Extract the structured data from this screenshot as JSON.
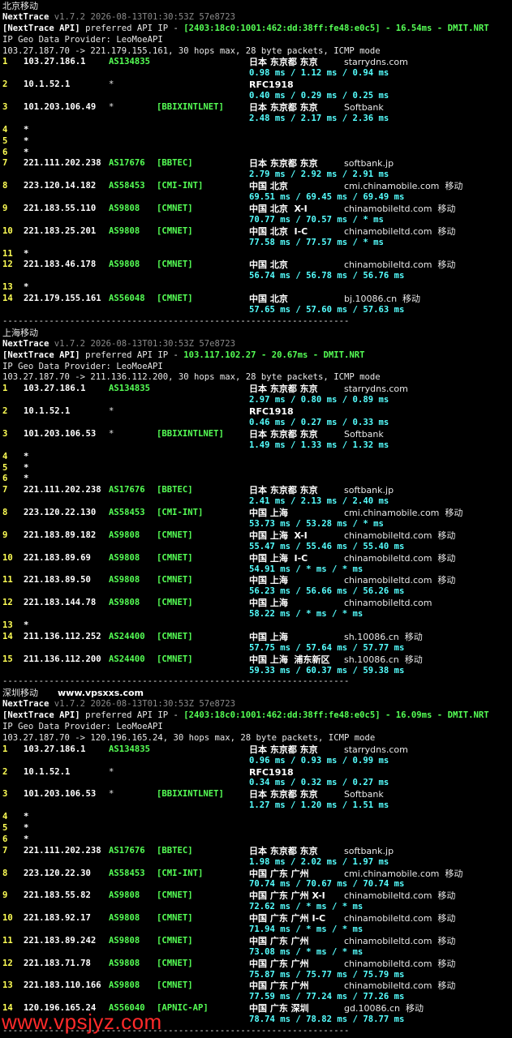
{
  "colors": {
    "hop": "#ffff55",
    "asn": "#55ff55",
    "net": "#55ff55",
    "rtt": "#55ffff",
    "geo": "#ffffff",
    "version": "#8a8a8a"
  },
  "watermark": "www.vpsjyz.com",
  "sections": [
    {
      "title": "北京移动",
      "brand": "",
      "app_name": "NextTrace",
      "version": "v1.7.2 2026-08-13T01:30:53Z 57e8723",
      "api_tag": "[NextTrace API]",
      "api_text": "preferred API IP -",
      "api_ip": "[2403:18c0:1001:462:dd:38ff:fe48:e0c5]",
      "api_latency": "- 16.54ms - DMIT.NRT",
      "geo_provider": "IP Geo Data Provider: LeoMoeAPI",
      "trace_header": "103.27.187.70 -> 221.179.155.161, 30 hops max, 28 byte packets, ICMP mode",
      "hops": [
        {
          "n": "1",
          "ip": "103.27.186.1",
          "asn": "AS134835",
          "net": "",
          "geo": "日本 东京都 东京",
          "isp": "starrydns.com",
          "rtt": "0.98 ms / 1.12 ms / 0.94 ms"
        },
        {
          "n": "2",
          "ip": "10.1.52.1",
          "asn": "*",
          "net": "",
          "geo": "RFC1918",
          "isp": "",
          "rtt": "0.40 ms / 0.29 ms / 0.25 ms"
        },
        {
          "n": "3",
          "ip": "101.203.106.49",
          "asn": "*",
          "net": "[BBIXINTLNET]",
          "geo": "日本 东京都 东京",
          "isp": "Softbank",
          "rtt": "2.48 ms / 2.17 ms / 2.36 ms"
        },
        {
          "n": "4",
          "ip": "*",
          "star": true
        },
        {
          "n": "5",
          "ip": "*",
          "star": true
        },
        {
          "n": "6",
          "ip": "*",
          "star": true
        },
        {
          "n": "7",
          "ip": "221.111.202.238",
          "asn": "AS17676",
          "net": "[BBTEC]",
          "geo": "日本 东京都 东京",
          "isp": "softbank.jp",
          "rtt": "2.79 ms / 2.92 ms / 2.91 ms"
        },
        {
          "n": "8",
          "ip": "223.120.14.182",
          "asn": "AS58453",
          "net": "[CMI-INT]",
          "geo": "中国 北京",
          "isp": "cmi.chinamobile.com  移动",
          "rtt": "69.51 ms / 69.45 ms / 69.49 ms"
        },
        {
          "n": "9",
          "ip": "221.183.55.110",
          "asn": "AS9808",
          "net": "[CMNET]",
          "geo": "中国 北京  X-I",
          "isp": "chinamobileltd.com  移动",
          "rtt": "70.77 ms / 70.57 ms / * ms"
        },
        {
          "n": "10",
          "ip": "221.183.25.201",
          "asn": "AS9808",
          "net": "[CMNET]",
          "geo": "中国 北京  I-C",
          "isp": "chinamobileltd.com  移动",
          "rtt": "77.58 ms / 77.57 ms / * ms"
        },
        {
          "n": "11",
          "ip": "*",
          "star": true
        },
        {
          "n": "12",
          "ip": "221.183.46.178",
          "asn": "AS9808",
          "net": "[CMNET]",
          "geo": "中国 北京",
          "isp": "chinamobileltd.com  移动",
          "rtt": "56.74 ms / 56.78 ms / 56.76 ms"
        },
        {
          "n": "13",
          "ip": "*",
          "star": true
        },
        {
          "n": "14",
          "ip": "221.179.155.161",
          "asn": "AS56048",
          "net": "[CMNET]",
          "geo": "中国 北京",
          "isp": "bj.10086.cn  移动",
          "rtt": "57.65 ms / 57.60 ms / 57.63 ms"
        }
      ]
    },
    {
      "title": "上海移动",
      "brand": "",
      "app_name": "NextTrace",
      "version": "v1.7.2 2026-08-13T01:30:53Z 57e8723",
      "api_tag": "[NextTrace API]",
      "api_text": "preferred API IP -",
      "api_ip": "103.117.102.27",
      "api_latency": "- 20.67ms - DMIT.NRT",
      "geo_provider": "IP Geo Data Provider: LeoMoeAPI",
      "trace_header": "103.27.187.70 -> 211.136.112.200, 30 hops max, 28 byte packets, ICMP mode",
      "hops": [
        {
          "n": "1",
          "ip": "103.27.186.1",
          "asn": "AS134835",
          "net": "",
          "geo": "日本 东京都 东京",
          "isp": "starrydns.com",
          "rtt": "2.97 ms / 0.80 ms / 0.89 ms"
        },
        {
          "n": "2",
          "ip": "10.1.52.1",
          "asn": "*",
          "net": "",
          "geo": "RFC1918",
          "isp": "",
          "rtt": "0.46 ms / 0.27 ms / 0.33 ms"
        },
        {
          "n": "3",
          "ip": "101.203.106.53",
          "asn": "*",
          "net": "[BBIXINTLNET]",
          "geo": "日本 东京都 东京",
          "isp": "Softbank",
          "rtt": "1.49 ms / 1.33 ms / 1.32 ms"
        },
        {
          "n": "4",
          "ip": "*",
          "star": true
        },
        {
          "n": "5",
          "ip": "*",
          "star": true
        },
        {
          "n": "6",
          "ip": "*",
          "star": true
        },
        {
          "n": "7",
          "ip": "221.111.202.238",
          "asn": "AS17676",
          "net": "[BBTEC]",
          "geo": "日本 东京都 东京",
          "isp": "softbank.jp",
          "rtt": "2.41 ms / 2.13 ms / 2.40 ms"
        },
        {
          "n": "8",
          "ip": "223.120.22.130",
          "asn": "AS58453",
          "net": "[CMI-INT]",
          "geo": "中国 上海",
          "isp": "cmi.chinamobile.com  移动",
          "rtt": "53.73 ms / 53.28 ms / * ms"
        },
        {
          "n": "9",
          "ip": "221.183.89.182",
          "asn": "AS9808",
          "net": "[CMNET]",
          "geo": "中国 上海  X-I",
          "isp": "chinamobileltd.com  移动",
          "rtt": "55.47 ms / 55.46 ms / 55.40 ms"
        },
        {
          "n": "10",
          "ip": "221.183.89.69",
          "asn": "AS9808",
          "net": "[CMNET]",
          "geo": "中国 上海  I-C",
          "isp": "chinamobileltd.com  移动",
          "rtt": "54.91 ms / * ms / * ms"
        },
        {
          "n": "11",
          "ip": "221.183.89.50",
          "asn": "AS9808",
          "net": "[CMNET]",
          "geo": "中国 上海",
          "isp": "chinamobileltd.com  移动",
          "rtt": "56.23 ms / 56.66 ms / 56.26 ms"
        },
        {
          "n": "12",
          "ip": "221.183.144.78",
          "asn": "AS9808",
          "net": "[CMNET]",
          "geo": "中国 上海",
          "isp": "chinamobileltd.com",
          "rtt": "58.22 ms / * ms / * ms"
        },
        {
          "n": "13",
          "ip": "*",
          "star": true
        },
        {
          "n": "14",
          "ip": "211.136.112.252",
          "asn": "AS24400",
          "net": "[CMNET]",
          "geo": "中国 上海",
          "isp": "sh.10086.cn  移动",
          "rtt": "57.75 ms / 57.64 ms / 57.77 ms"
        },
        {
          "n": "15",
          "ip": "211.136.112.200",
          "asn": "AS24400",
          "net": "[CMNET]",
          "geo": "中国 上海  浦东新区",
          "isp": "sh.10086.cn  移动",
          "rtt": "59.33 ms / 60.37 ms / 59.38 ms"
        }
      ]
    },
    {
      "title": "深圳移动",
      "brand": "www.vpsxxs.com",
      "app_name": "NextTrace",
      "version": "v1.7.2 2026-08-13T01:30:53Z 57e8723",
      "api_tag": "[NextTrace API]",
      "api_text": "preferred API IP -",
      "api_ip": "[2403:18c0:1001:462:dd:38ff:fe48:e0c5]",
      "api_latency": "- 16.09ms - DMIT.NRT",
      "geo_provider": "IP Geo Data Provider: LeoMoeAPI",
      "trace_header": "103.27.187.70 -> 120.196.165.24, 30 hops max, 28 byte packets, ICMP mode",
      "hops": [
        {
          "n": "1",
          "ip": "103.27.186.1",
          "asn": "AS134835",
          "net": "",
          "geo": "日本 东京都 东京",
          "isp": "starrydns.com",
          "rtt": "0.96 ms / 0.93 ms / 0.99 ms"
        },
        {
          "n": "2",
          "ip": "10.1.52.1",
          "asn": "*",
          "net": "",
          "geo": "RFC1918",
          "isp": "",
          "rtt": "0.34 ms / 0.32 ms / 0.27 ms"
        },
        {
          "n": "3",
          "ip": "101.203.106.53",
          "asn": "*",
          "net": "[BBIXINTLNET]",
          "geo": "日本 东京都 东京",
          "isp": "Softbank",
          "rtt": "1.27 ms / 1.20 ms / 1.51 ms"
        },
        {
          "n": "4",
          "ip": "*",
          "star": true
        },
        {
          "n": "5",
          "ip": "*",
          "star": true
        },
        {
          "n": "6",
          "ip": "*",
          "star": true
        },
        {
          "n": "7",
          "ip": "221.111.202.238",
          "asn": "AS17676",
          "net": "[BBTEC]",
          "geo": "日本 东京都 东京",
          "isp": "softbank.jp",
          "rtt": "1.98 ms / 2.02 ms / 1.97 ms"
        },
        {
          "n": "8",
          "ip": "223.120.22.30",
          "asn": "AS58453",
          "net": "[CMI-INT]",
          "geo": "中国 广东 广州",
          "isp": "cmi.chinamobile.com  移动",
          "rtt": "70.74 ms / 70.67 ms / 70.74 ms"
        },
        {
          "n": "9",
          "ip": "221.183.55.82",
          "asn": "AS9808",
          "net": "[CMNET]",
          "geo": "中国 广东 广州 X-I",
          "isp": "chinamobileltd.com  移动",
          "rtt": "72.62 ms / * ms / * ms"
        },
        {
          "n": "10",
          "ip": "221.183.92.17",
          "asn": "AS9808",
          "net": "[CMNET]",
          "geo": "中国 广东 广州 I-C",
          "isp": "chinamobileltd.com  移动",
          "rtt": "71.94 ms / * ms / * ms"
        },
        {
          "n": "11",
          "ip": "221.183.89.242",
          "asn": "AS9808",
          "net": "[CMNET]",
          "geo": "中国 广东 广州",
          "isp": "chinamobileltd.com  移动",
          "rtt": "73.08 ms / * ms / * ms"
        },
        {
          "n": "12",
          "ip": "221.183.71.78",
          "asn": "AS9808",
          "net": "[CMNET]",
          "geo": "中国 广东 广州",
          "isp": "chinamobileltd.com  移动",
          "rtt": "75.87 ms / 75.77 ms / 75.79 ms"
        },
        {
          "n": "13",
          "ip": "221.183.110.166",
          "asn": "AS9808",
          "net": "[CMNET]",
          "geo": "中国 广东 广州",
          "isp": "chinamobileltd.com  移动",
          "rtt": "77.59 ms / 77.24 ms / 77.26 ms"
        },
        {
          "n": "14",
          "ip": "120.196.165.24",
          "asn": "AS56040",
          "net": "[APNIC-AP]",
          "geo": "中国 广东 深圳",
          "isp": "gd.10086.cn  移动",
          "rtt": "78.74 ms / 78.82 ms / 78.77 ms"
        }
      ]
    }
  ],
  "separator": "-------------------------------------------------------------------"
}
